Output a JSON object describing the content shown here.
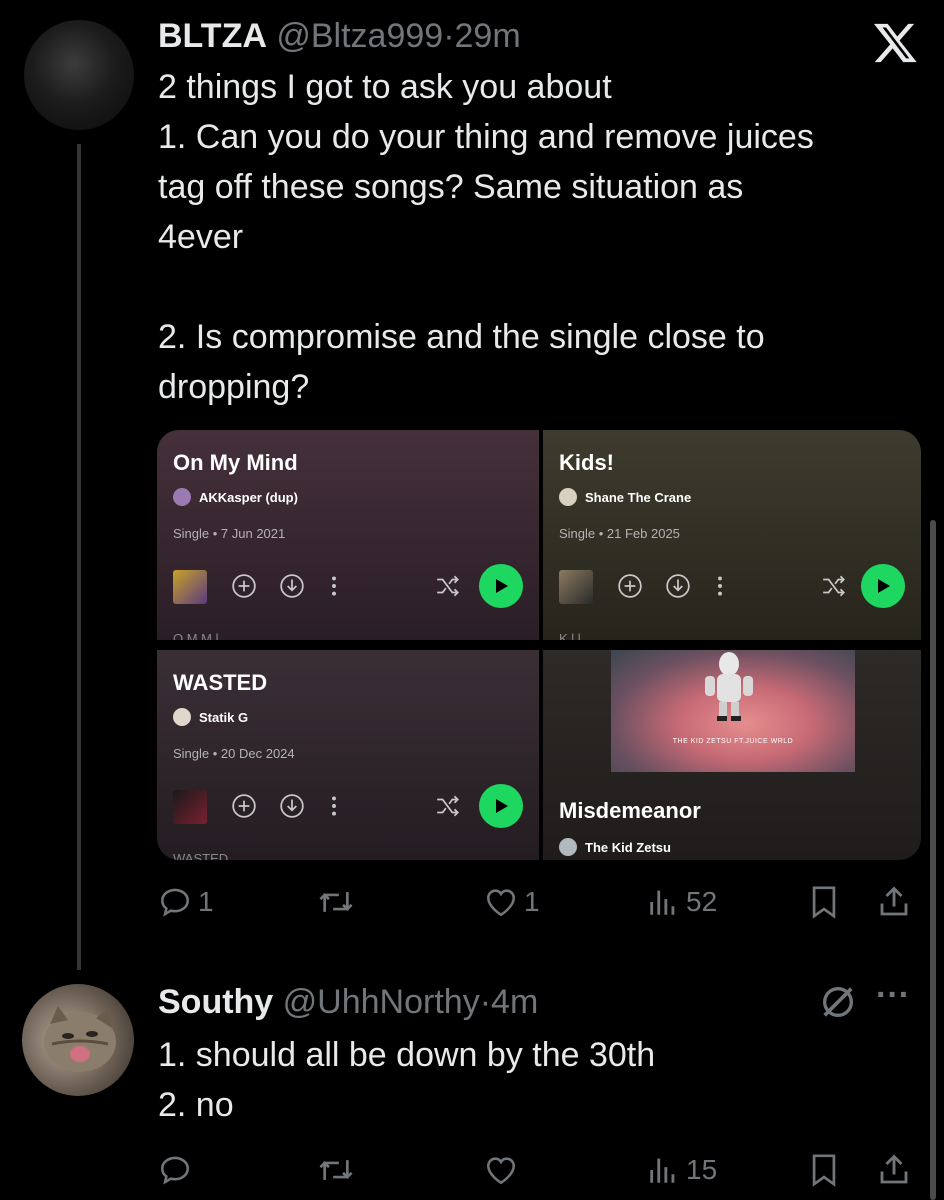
{
  "post": {
    "display_name": "BLTZA",
    "handle": "@Bltza999",
    "dot": "·",
    "time": "29m",
    "lines": [
      "2 things I got to ask you about",
      "1. Can you do your thing and remove juices",
      "tag off these songs? Same situation as",
      "4ever",
      "",
      "2. Is compromise and the single close to",
      "dropping?"
    ],
    "media": [
      {
        "title": "On My Mind",
        "artist": "AKKasper (dup)",
        "meta": "Single • 7 Jun 2021",
        "cut": "O  M  M  l"
      },
      {
        "title": "Kids!",
        "artist": "Shane The Crane",
        "meta": "Single • 21 Feb 2025",
        "cut": "K  l  l"
      },
      {
        "title": "WASTED",
        "artist": "Statik G",
        "meta": "Single • 20 Dec 2024",
        "cut": "WASTED"
      },
      {
        "title": "Misdemeanor",
        "artist": "The Kid Zetsu",
        "cover_caption": "THE KID ZETSU FT.JUICE WRLD"
      }
    ],
    "stats": {
      "replies": "1",
      "likes": "1",
      "views": "52"
    }
  },
  "reply": {
    "display_name": "Southy",
    "handle": "@UhhNorthy",
    "dot": "·",
    "time": "4m",
    "lines": [
      "1. should all be down by the 30th",
      "2. no"
    ],
    "stats": {
      "views": "15"
    },
    "more": "···"
  },
  "icons": [
    "x-logo-icon",
    "reply-icon",
    "retweet-icon",
    "like-icon",
    "views-icon",
    "bookmark-icon",
    "share-icon",
    "grok-icon",
    "more-icon",
    "add-icon",
    "download-icon",
    "kebab-icon",
    "shuffle-icon",
    "play-icon"
  ],
  "colors": {
    "background": "#000000",
    "text": "#e7e9ea",
    "muted": "#71767b",
    "spotify_green": "#1ed760"
  }
}
